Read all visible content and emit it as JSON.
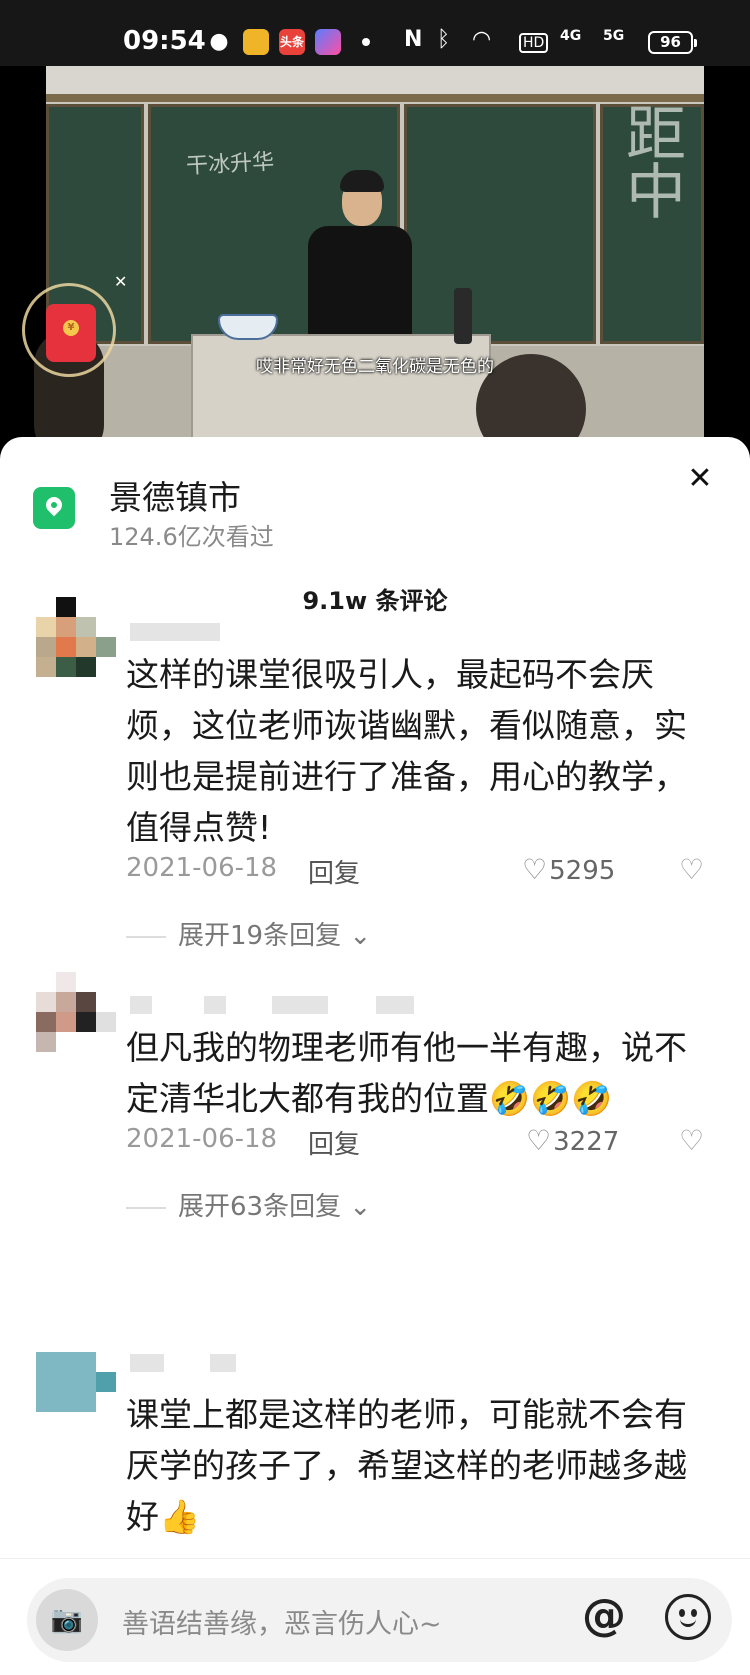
{
  "status_bar": {
    "time": "09:54",
    "battery": "96",
    "toutiao_label": "头条",
    "hd_label": "HD",
    "net_4g": "4G",
    "net_5g": "5G"
  },
  "video": {
    "subtitle": "哎非常好无色二氧化碳是无色的",
    "chalk_text": "干冰升华",
    "chalk_text_right": "距中",
    "red_packet_symbol": "¥"
  },
  "location": {
    "title": "景德镇市",
    "views": "124.6亿次看过"
  },
  "comment_count": "9.1w 条评论",
  "comments": [
    {
      "text": "这样的课堂很吸引人，最起码不会厌烦，这位老师诙谐幽默，看似随意，实则也是提前进行了准备，用心的教学，值得点赞!",
      "date": "2021-06-18",
      "reply_label": "回复",
      "likes": "5295",
      "expand": "展开19条回复"
    },
    {
      "text": "但凡我的物理老师有他一半有趣，说不定清华北大都有我的位置🤣🤣🤣",
      "date": "2021-06-18",
      "reply_label": "回复",
      "likes": "3227",
      "expand": "展开63条回复"
    },
    {
      "text": "课堂上都是这样的老师，可能就不会有厌学的孩子了，希望这样的老师越多越好👍"
    }
  ],
  "input": {
    "placeholder": "善语结善缘，恶言伤人心~",
    "at_label": "@"
  },
  "colors": {
    "location_icon": "#1fbf6b",
    "red_packet": "#e5323c",
    "sheet_bg": "#ffffff"
  }
}
